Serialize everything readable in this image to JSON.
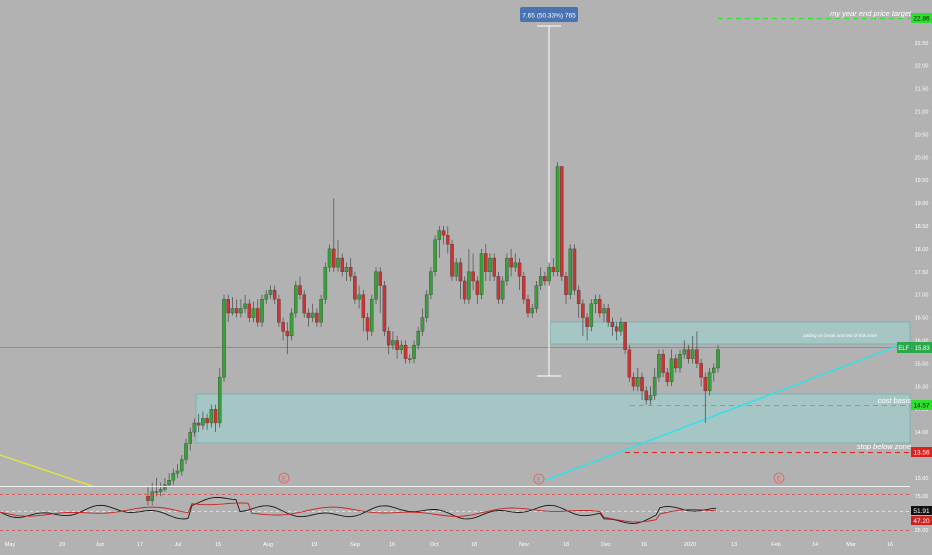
{
  "chart_data": {
    "type": "candlestick",
    "symbol": "ELF",
    "last_price_label": "ELF · 15.83",
    "y_ticks": [
      "22.50",
      "22.00",
      "21.50",
      "21.00",
      "20.50",
      "20.00",
      "19.50",
      "19.00",
      "18.50",
      "18.00",
      "17.50",
      "17.00",
      "16.50",
      "16.00",
      "15.50",
      "15.00",
      "14.50",
      "14.00",
      "13.50",
      "13.00"
    ],
    "x_ticks": [
      "May",
      "20",
      "Jun",
      "17",
      "Jul",
      "15",
      "Aug",
      "19",
      "Sep",
      "16",
      "Oct",
      "18",
      "Nov",
      "18",
      "Dec",
      "16",
      "2020",
      "13",
      "Feb",
      "14",
      "Mar",
      "16"
    ],
    "price_labels": {
      "target": "22.86",
      "last": "15.83",
      "cost_basis": "14.57",
      "stop": "13.56"
    },
    "measure_label": "7.65 (50.33%) 765",
    "annotations": {
      "year_end_target": "my year end price target",
      "adding_zone": "adding on break and test of this zone",
      "cost_basis": "cost basis",
      "stop": "stop below zone"
    },
    "indicator": {
      "values_labels": [
        "51.91",
        "47.20"
      ],
      "levels": [
        "75.00",
        "25.00"
      ]
    },
    "event_marker": "E",
    "candles": [
      [
        12.6,
        12.5,
        12.8,
        12.4
      ],
      [
        12.5,
        12.7,
        12.9,
        12.4
      ],
      [
        12.7,
        12.7,
        13.0,
        12.6
      ],
      [
        12.7,
        12.75,
        12.9,
        12.6
      ],
      [
        12.75,
        12.85,
        13.0,
        12.7
      ],
      [
        12.85,
        12.95,
        13.1,
        12.8
      ],
      [
        12.95,
        13.1,
        13.2,
        12.85
      ],
      [
        13.1,
        13.15,
        13.3,
        13.0
      ],
      [
        13.15,
        13.4,
        13.5,
        13.05
      ],
      [
        13.4,
        13.75,
        13.85,
        13.3
      ],
      [
        13.75,
        14.0,
        14.1,
        13.6
      ],
      [
        14.0,
        14.2,
        14.3,
        13.9
      ],
      [
        14.2,
        14.15,
        14.4,
        14.0
      ],
      [
        14.15,
        14.3,
        14.45,
        14.05
      ],
      [
        14.3,
        14.2,
        14.4,
        14.05
      ],
      [
        14.2,
        14.5,
        14.6,
        14.1
      ],
      [
        14.5,
        14.2,
        14.6,
        14.0
      ],
      [
        14.2,
        15.2,
        15.4,
        14.1
      ],
      [
        15.2,
        16.9,
        17.0,
        15.1
      ],
      [
        16.9,
        16.6,
        17.0,
        16.4
      ],
      [
        16.6,
        16.7,
        16.95,
        16.55
      ],
      [
        16.7,
        16.6,
        16.9,
        16.5
      ],
      [
        16.6,
        16.7,
        16.9,
        16.5
      ],
      [
        16.7,
        16.8,
        17.0,
        16.6
      ],
      [
        16.8,
        16.5,
        16.9,
        16.4
      ],
      [
        16.5,
        16.7,
        16.85,
        16.4
      ],
      [
        16.7,
        16.4,
        16.9,
        16.3
      ],
      [
        16.4,
        16.9,
        17.0,
        16.3
      ],
      [
        16.9,
        17.0,
        17.1,
        16.8
      ],
      [
        17.0,
        17.1,
        17.2,
        16.9
      ],
      [
        17.1,
        16.9,
        17.2,
        16.8
      ],
      [
        16.9,
        16.4,
        17.0,
        16.3
      ],
      [
        16.4,
        16.2,
        16.5,
        16.0
      ],
      [
        16.2,
        16.1,
        16.4,
        15.7
      ],
      [
        16.1,
        16.6,
        16.7,
        16.0
      ],
      [
        16.6,
        17.2,
        17.3,
        16.5
      ],
      [
        17.2,
        17.0,
        17.4,
        16.9
      ],
      [
        17.0,
        16.6,
        17.1,
        16.5
      ],
      [
        16.6,
        16.5,
        16.7,
        16.3
      ],
      [
        16.5,
        16.6,
        16.8,
        16.4
      ],
      [
        16.6,
        16.4,
        16.7,
        16.3
      ],
      [
        16.4,
        16.9,
        17.0,
        16.3
      ],
      [
        16.9,
        17.6,
        17.7,
        16.8
      ],
      [
        17.6,
        18.0,
        18.1,
        17.5
      ],
      [
        18.0,
        17.6,
        19.1,
        17.5
      ],
      [
        17.6,
        17.8,
        18.2,
        17.5
      ],
      [
        17.8,
        17.5,
        17.9,
        17.4
      ],
      [
        17.5,
        17.6,
        17.7,
        17.3
      ],
      [
        17.6,
        17.4,
        17.8,
        17.3
      ],
      [
        17.4,
        16.9,
        17.5,
        16.8
      ],
      [
        16.9,
        17.0,
        17.2,
        16.7
      ],
      [
        17.0,
        16.5,
        17.1,
        16.2
      ],
      [
        16.5,
        16.2,
        16.6,
        16.0
      ],
      [
        16.2,
        16.9,
        17.0,
        16.1
      ],
      [
        16.9,
        17.5,
        17.6,
        16.8
      ],
      [
        17.5,
        17.2,
        17.6,
        16.6
      ],
      [
        17.2,
        16.2,
        17.3,
        16.1
      ],
      [
        16.2,
        15.9,
        16.3,
        15.7
      ],
      [
        15.9,
        16.0,
        16.2,
        15.8
      ],
      [
        16.0,
        15.8,
        16.1,
        15.6
      ],
      [
        15.8,
        15.9,
        16.0,
        15.7
      ],
      [
        15.9,
        15.6,
        16.0,
        15.5
      ],
      [
        15.6,
        15.6,
        15.7,
        15.5
      ],
      [
        15.6,
        15.9,
        16.0,
        15.5
      ],
      [
        15.9,
        16.2,
        16.3,
        15.8
      ],
      [
        16.2,
        16.5,
        16.7,
        16.1
      ],
      [
        16.5,
        17.0,
        17.1,
        16.4
      ],
      [
        17.0,
        17.5,
        17.6,
        16.9
      ],
      [
        17.5,
        18.2,
        18.3,
        17.4
      ],
      [
        18.2,
        18.4,
        18.5,
        17.8
      ],
      [
        18.4,
        18.3,
        18.5,
        18.1
      ],
      [
        18.3,
        18.1,
        18.5,
        17.9
      ],
      [
        18.1,
        17.4,
        18.2,
        17.3
      ],
      [
        17.4,
        17.7,
        17.8,
        17.3
      ],
      [
        17.7,
        17.3,
        17.8,
        16.9
      ],
      [
        17.3,
        16.9,
        17.4,
        16.8
      ],
      [
        16.9,
        17.5,
        18.0,
        16.8
      ],
      [
        17.5,
        17.3,
        17.9,
        17.1
      ],
      [
        17.3,
        17.0,
        17.4,
        16.8
      ],
      [
        17.0,
        17.9,
        18.0,
        16.9
      ],
      [
        17.9,
        17.5,
        18.1,
        17.3
      ],
      [
        17.5,
        17.8,
        17.9,
        17.3
      ],
      [
        17.8,
        17.4,
        17.9,
        17.3
      ],
      [
        17.4,
        16.9,
        17.5,
        16.8
      ],
      [
        16.9,
        17.3,
        17.4,
        16.8
      ],
      [
        17.3,
        17.8,
        17.9,
        17.2
      ],
      [
        17.8,
        17.6,
        18.0,
        17.4
      ],
      [
        17.6,
        17.7,
        17.9,
        17.5
      ],
      [
        17.7,
        17.4,
        17.8,
        17.1
      ],
      [
        17.4,
        16.9,
        17.5,
        16.8
      ],
      [
        16.9,
        16.6,
        17.0,
        16.5
      ],
      [
        16.6,
        16.7,
        16.8,
        16.5
      ],
      [
        16.7,
        17.2,
        17.3,
        16.6
      ],
      [
        17.2,
        17.4,
        17.6,
        17.1
      ],
      [
        17.4,
        17.3,
        17.5,
        17.2
      ],
      [
        17.3,
        17.6,
        17.7,
        17.2
      ],
      [
        17.6,
        17.5,
        17.8,
        17.4
      ],
      [
        17.5,
        19.8,
        19.9,
        17.4
      ],
      [
        19.8,
        17.4,
        19.8,
        17.3
      ],
      [
        17.4,
        17.0,
        17.5,
        16.8
      ],
      [
        17.0,
        18.0,
        18.1,
        16.9
      ],
      [
        18.0,
        17.1,
        18.1,
        17.0
      ],
      [
        17.1,
        16.8,
        17.2,
        16.5
      ],
      [
        16.8,
        16.5,
        16.9,
        16.1
      ],
      [
        16.5,
        16.3,
        16.6,
        16.0
      ],
      [
        16.3,
        16.8,
        16.9,
        16.2
      ],
      [
        16.8,
        16.9,
        17.0,
        16.6
      ],
      [
        16.9,
        16.6,
        17.0,
        16.5
      ],
      [
        16.6,
        16.7,
        16.8,
        16.4
      ],
      [
        16.7,
        16.4,
        16.8,
        16.3
      ],
      [
        16.4,
        16.3,
        16.5,
        16.1
      ],
      [
        16.3,
        16.2,
        16.4,
        16.0
      ],
      [
        16.2,
        16.4,
        16.5,
        16.1
      ],
      [
        16.4,
        15.8,
        16.0,
        15.7
      ],
      [
        15.8,
        15.2,
        15.9,
        15.1
      ],
      [
        15.2,
        15.0,
        15.3,
        14.9
      ],
      [
        15.0,
        15.2,
        15.4,
        14.9
      ],
      [
        15.2,
        14.9,
        15.3,
        14.7
      ],
      [
        14.9,
        14.7,
        15.0,
        14.6
      ],
      [
        14.7,
        14.8,
        15.0,
        14.6
      ],
      [
        14.8,
        15.2,
        15.4,
        14.7
      ],
      [
        15.2,
        15.7,
        15.8,
        15.1
      ],
      [
        15.7,
        15.3,
        15.8,
        15.2
      ],
      [
        15.3,
        15.1,
        15.4,
        15.0
      ],
      [
        15.1,
        15.6,
        15.8,
        15.0
      ],
      [
        15.6,
        15.4,
        15.7,
        15.3
      ],
      [
        15.4,
        15.7,
        15.8,
        15.3
      ],
      [
        15.7,
        15.8,
        16.0,
        15.6
      ],
      [
        15.8,
        15.6,
        15.9,
        15.5
      ],
      [
        15.6,
        15.8,
        16.1,
        15.5
      ],
      [
        15.8,
        15.5,
        16.2,
        15.4
      ],
      [
        15.5,
        15.2,
        15.6,
        15.0
      ],
      [
        15.2,
        14.9,
        15.3,
        14.2
      ],
      [
        14.9,
        15.3,
        15.4,
        14.8
      ],
      [
        15.3,
        15.4,
        15.5,
        15.1
      ],
      [
        15.4,
        15.8,
        15.9,
        15.3
      ]
    ]
  }
}
